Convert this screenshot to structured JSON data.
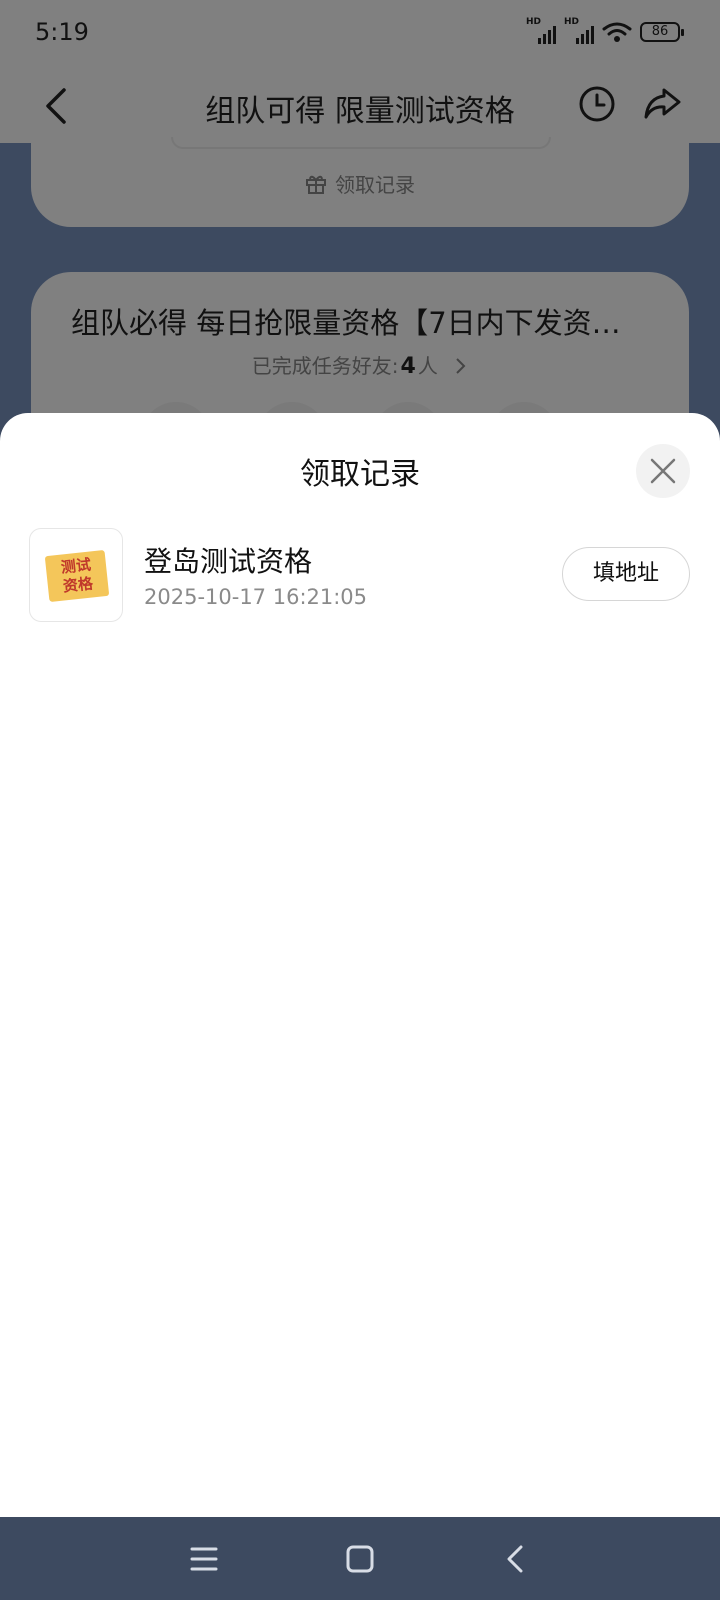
{
  "status_bar": {
    "time": "5:19",
    "signal_labels": [
      "HD",
      "HD"
    ],
    "battery": "86"
  },
  "header": {
    "title": "组队可得 限量测试资格",
    "icons": [
      "back-icon",
      "history-clock-icon",
      "share-icon"
    ]
  },
  "background": {
    "claim_link": "领取记录",
    "card_title": "组队必得 每日抢限量资格【7日内下发资…",
    "friends_label": "已完成任务好友:",
    "friends_count": "4",
    "friends_unit": "人"
  },
  "sheet": {
    "title": "领取记录",
    "records": [
      {
        "thumb_text_1": "测试",
        "thumb_text_2": "资格",
        "name": "登岛测试资格",
        "time": "2025-10-17 16:21:05",
        "action_label": "填地址"
      }
    ]
  },
  "nav_bar": {
    "icons": [
      "menu-icon",
      "home-icon",
      "back-icon"
    ]
  },
  "colors": {
    "overlay_gray": "#808080",
    "page_bg": "#3d4a60",
    "sheet_bg": "#ffffff",
    "ticket_yellow": "#f4c65a",
    "ticket_red": "#c0392b"
  }
}
